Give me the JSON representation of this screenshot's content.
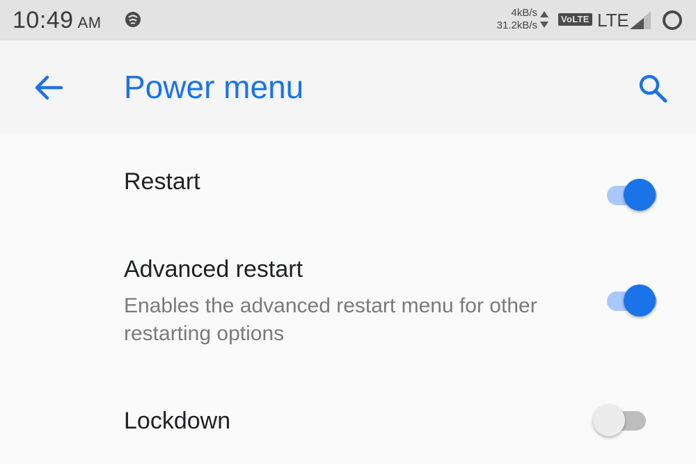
{
  "status_bar": {
    "time": "10:49",
    "ampm": "AM",
    "upload_speed": "4kB/s",
    "download_speed": "31.2kB/s",
    "volte_label": "VoLTE",
    "network_type": "LTE"
  },
  "app_bar": {
    "title": "Power menu"
  },
  "settings": [
    {
      "title": "Restart",
      "summary": "",
      "enabled": true
    },
    {
      "title": "Advanced restart",
      "summary": "Enables the advanced restart menu for other restarting options",
      "enabled": true
    },
    {
      "title": "Lockdown",
      "summary": "",
      "enabled": false
    }
  ],
  "colors": {
    "accent": "#1a73e8",
    "switch_on_track": "#a8c7fa",
    "switch_off_thumb": "#ececec"
  },
  "icons": {
    "back": "arrow-back-icon",
    "search": "search-icon",
    "notification": "app-notification-icon",
    "signal": "signal-icon",
    "battery": "battery-icon"
  }
}
